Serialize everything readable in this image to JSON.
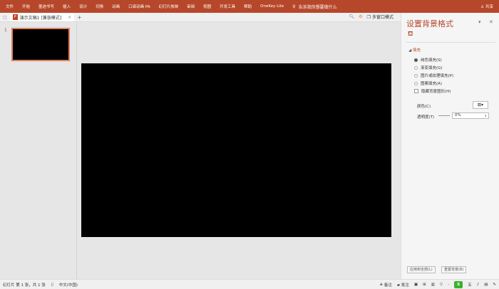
{
  "ribbon": {
    "tabs": [
      "文件",
      "开始",
      "墨迹书写",
      "插入",
      "设计",
      "切换",
      "动画",
      "口袋动画 PA",
      "幻灯片放映",
      "审阅",
      "视图",
      "开发工具",
      "帮助",
      "OneKey Lite"
    ],
    "tell_me": "告诉我你想要做什么",
    "share": "共享"
  },
  "tabstrip": {
    "doc_title": "演示文稿1 [兼容模式]",
    "close": "×",
    "add": "+",
    "multi_window": "多窗口模式"
  },
  "thumbnails": {
    "number": "1"
  },
  "pane": {
    "title": "设置背景格式",
    "section": "填充",
    "options": [
      "纯色填充(S)",
      "渐变填充(G)",
      "图片或纹理填充(P)",
      "图案填充(A)"
    ],
    "hide_graphics": "隐藏背景图形(H)",
    "color_label": "颜色(C)",
    "transparency_label": "透明度(T)",
    "transparency_value": "0%",
    "apply_all": "应用到全部(L)",
    "reset": "重置背景(B)"
  },
  "status": {
    "slide_info": "幻灯片 第 1 张，共 1 张",
    "language": "中文(中国)",
    "notes": "备注",
    "comments": "批注",
    "ime": "五"
  },
  "colors": {
    "accent": "#b7472a"
  }
}
